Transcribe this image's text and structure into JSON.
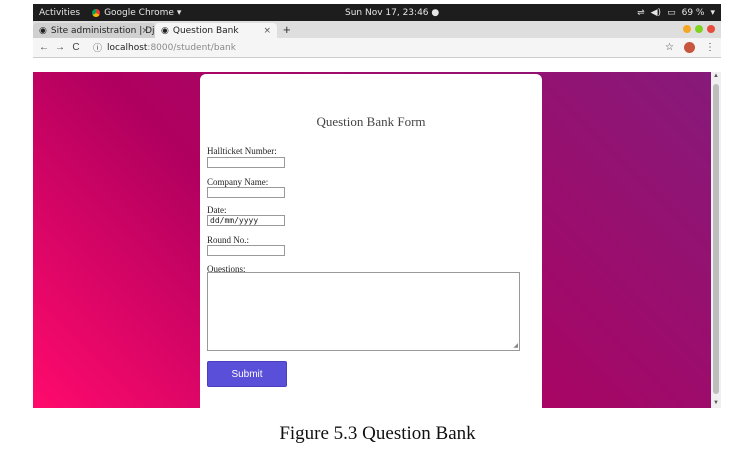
{
  "os_bar": {
    "activities": "Activities",
    "app_name": "Google Chrome ▾",
    "clock": "Sun Nov 17, 23:46 ●",
    "battery": "69 %"
  },
  "browser": {
    "tabs": [
      {
        "label": "Site administration | Djan",
        "close": "×"
      },
      {
        "label": "Question Bank",
        "close": "×"
      }
    ],
    "new_tab": "+",
    "url_host": "localhost",
    "url_path": ":8000/student/bank",
    "nav": {
      "back": "←",
      "forward": "→",
      "reload": "C",
      "info": "ⓘ"
    },
    "star": "☆",
    "menu": "⋮",
    "window_colors": [
      "#f5a623",
      "#7ed321",
      "#e74c3c"
    ]
  },
  "form": {
    "title": "Question Bank Form",
    "hallticket_label": "Hallticket Number:",
    "company_label": "Company Name:",
    "date_label": "Date:",
    "date_placeholder": "dd/mm/yyyy",
    "round_label": "Round No.:",
    "questions_label": "Questions:",
    "submit_label": "Submit"
  },
  "caption": "Figure 5.3 Question Bank",
  "colors": {
    "gradient_start": "#ff0a6c",
    "gradient_end": "#861a7a",
    "submit_bg": "#5a4fd8"
  }
}
